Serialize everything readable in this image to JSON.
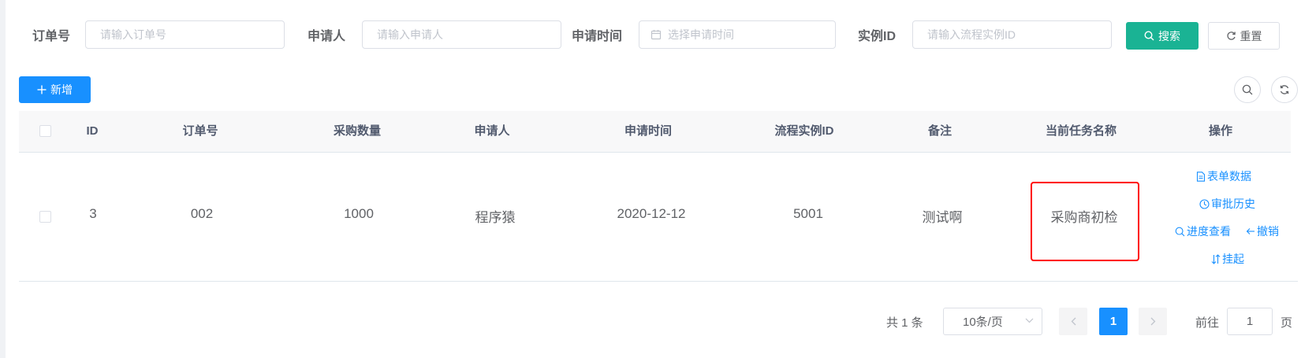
{
  "search": {
    "order_no": {
      "label": "订单号",
      "placeholder": "请输入订单号"
    },
    "applicant": {
      "label": "申请人",
      "placeholder": "请输入申请人"
    },
    "apply_time": {
      "label": "申请时间",
      "placeholder": "选择申请时间",
      "icon": "calendar-icon"
    },
    "instance_id": {
      "label": "实例ID",
      "placeholder": "请输入流程实例ID"
    },
    "search_button": "搜索",
    "reset_button": "重置"
  },
  "toolbar": {
    "add_button": "新增",
    "right_icons": [
      "search-icon",
      "refresh-icon"
    ]
  },
  "table": {
    "columns": [
      "ID",
      "订单号",
      "采购数量",
      "申请人",
      "申请时间",
      "流程实例ID",
      "备注",
      "当前任务名称",
      "操作"
    ],
    "rows": [
      {
        "id": "3",
        "order_no": "002",
        "quantity": "1000",
        "applicant": "程序猿",
        "apply_time": "2020-12-12",
        "instance_id": "5001",
        "remark": "测试啊",
        "current_task": "采购商初检",
        "actions": {
          "form_data": "表单数据",
          "history": "审批历史",
          "progress": "进度查看",
          "revoke": "撤销",
          "suspend": "挂起"
        }
      }
    ]
  },
  "pagination": {
    "total_text": "共 1 条",
    "page_size": "10条/页",
    "current_page": "1",
    "goto_prefix": "前往",
    "goto_value": "1",
    "goto_suffix": "页"
  },
  "colors": {
    "primary": "#1890ff",
    "search_button": "#1ab394",
    "highlight_border": "#ff0000"
  }
}
